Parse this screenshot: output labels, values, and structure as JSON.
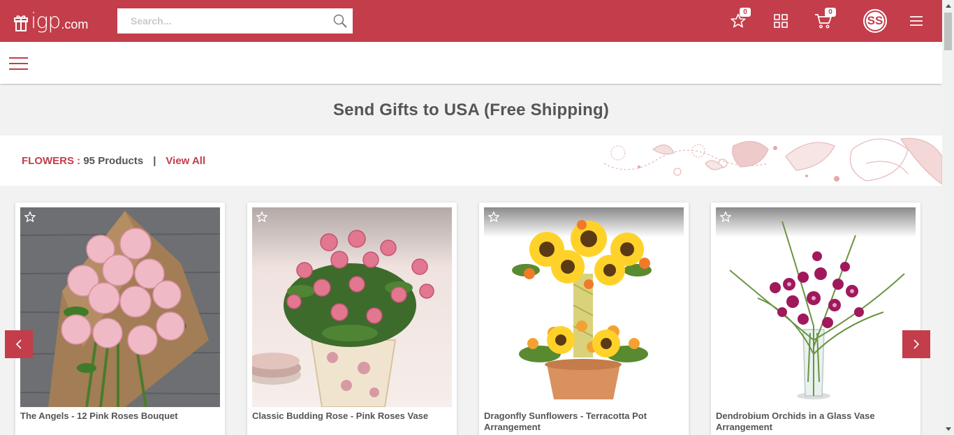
{
  "header": {
    "logo_word": "igp",
    "logo_domain": ".com",
    "search_placeholder": "Search...",
    "wishlist_count": "0",
    "cart_count": "0",
    "avatar_initials": "SS",
    "brand_color": "#c33d4a"
  },
  "page": {
    "title": "Send Gifts to USA (Free Shipping)"
  },
  "category": {
    "name": "FLOWERS",
    "separator_colon": " : ",
    "count_text": "95 Products",
    "divider": "|",
    "view_all": "View All"
  },
  "products": [
    {
      "name": "The Angels - 12 Pink Roses Bouquet",
      "icon": "star-outline-icon"
    },
    {
      "name": "Classic Budding Rose - Pink Roses Vase",
      "icon": "star-outline-icon"
    },
    {
      "name": "Dragonfly Sunflowers - Terracotta Pot Arrangement",
      "icon": "star-outline-icon"
    },
    {
      "name": "Dendrobium Orchids in a Glass Vase Arrangement",
      "icon": "star-outline-icon"
    }
  ],
  "carousel": {
    "prev_icon": "chevron-left-icon",
    "next_icon": "chevron-right-icon"
  }
}
